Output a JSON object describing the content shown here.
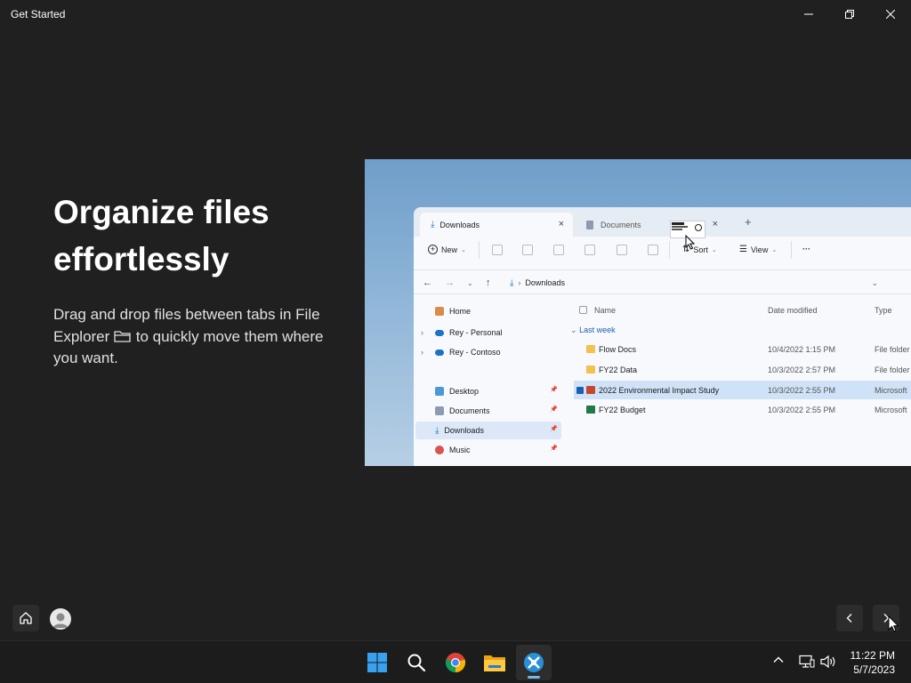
{
  "window": {
    "title": "Get Started"
  },
  "content": {
    "headline": "Organize files effortlessly",
    "desc_before": "Drag and drop files between tabs in File Explorer",
    "desc_after": "to quickly move them where you want."
  },
  "illustration": {
    "tabs": [
      {
        "label": "Downloads"
      },
      {
        "label": "Documents"
      }
    ],
    "toolbar": {
      "new": "New",
      "sort": "Sort",
      "view": "View",
      "more": "···"
    },
    "address": {
      "path": "Downloads"
    },
    "sidebar": [
      {
        "label": "Home"
      },
      {
        "label": "Rey - Personal"
      },
      {
        "label": "Rey - Contoso"
      },
      {
        "label": "Desktop"
      },
      {
        "label": "Documents"
      },
      {
        "label": "Downloads"
      },
      {
        "label": "Music"
      }
    ],
    "columns": {
      "name": "Name",
      "date": "Date modified",
      "type": "Type"
    },
    "group": "Last week",
    "files": [
      {
        "name": "Flow Docs",
        "date": "10/4/2022 1:15 PM",
        "type": "File folder"
      },
      {
        "name": "FY22 Data",
        "date": "10/3/2022 2:57 PM",
        "type": "File folder"
      },
      {
        "name": "2022 Environmental Impact Study",
        "date": "10/3/2022 2:55 PM",
        "type": "Microsoft"
      },
      {
        "name": "FY22 Budget",
        "date": "10/3/2022 2:55 PM",
        "type": "Microsoft"
      }
    ]
  },
  "taskbar": {
    "time": "11:22 PM",
    "date": "5/7/2023"
  },
  "colors": {
    "background": "#202020",
    "accent": "#76b9ed"
  }
}
